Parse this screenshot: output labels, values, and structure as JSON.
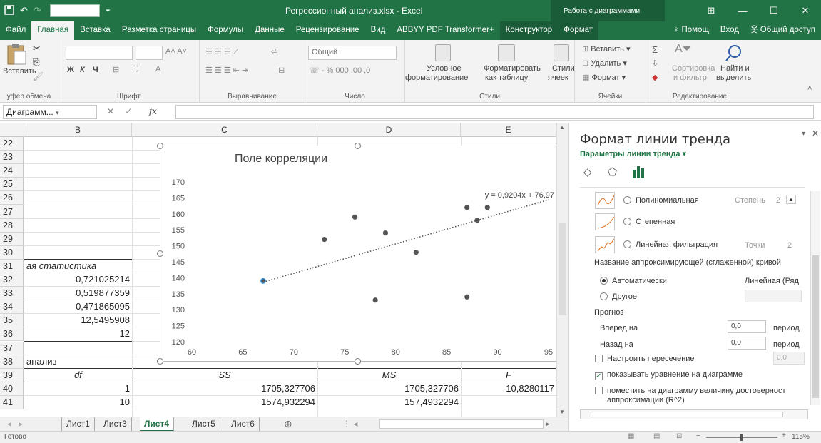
{
  "titlebar": {
    "title": "Регрессионный анализ.xlsx - Excel",
    "context": "Работа с диаграммами"
  },
  "tabs": [
    "Файл",
    "Главная",
    "Вставка",
    "Разметка страницы",
    "Формулы",
    "Данные",
    "Рецензирование",
    "Вид",
    "ABBYY PDF Transformer+",
    "Конструктор",
    "Формат"
  ],
  "tabs_right": {
    "help": "Помощ",
    "signin": "Вход",
    "share": "Общий доступ"
  },
  "ribbon": {
    "paste": "Вставить",
    "clipboard": "уфер обмена",
    "font_group": "Шрифт",
    "bold": "Ж",
    "italic": "К",
    "underline": "Ч",
    "align_group": "Выравнивание",
    "number_format": "Общий",
    "number_group": "Число",
    "cond_format_1": "Условное",
    "cond_format_2": "форматирование",
    "as_table_1": "Форматировать",
    "as_table_2": "как таблицу",
    "styles_1": "Стили",
    "styles_2": "ячеек",
    "styles_group": "Стили",
    "insert": "Вставить",
    "delete": "Удалить",
    "format": "Формат",
    "cells_group": "Ячейки",
    "sort_1": "Сортировка",
    "sort_2": "и фильтр",
    "find_1": "Найти и",
    "find_2": "выделить",
    "edit_group": "Редактирование"
  },
  "formula_bar": {
    "name_box": "Диаграмм...",
    "fx": "fx"
  },
  "columns": [
    "B",
    "C",
    "D",
    "E"
  ],
  "rows": [
    {
      "n": "22",
      "b": "",
      "c": "",
      "d": "",
      "e": ""
    },
    {
      "n": "23",
      "b": "",
      "c": "",
      "d": "",
      "e": ""
    },
    {
      "n": "24",
      "b": "",
      "c": "",
      "d": "",
      "e": ""
    },
    {
      "n": "25",
      "b": "",
      "c": "",
      "d": "",
      "e": ""
    },
    {
      "n": "26",
      "b": "",
      "c": "",
      "d": "",
      "e": ""
    },
    {
      "n": "27",
      "b": "",
      "c": "",
      "d": "",
      "e": ""
    },
    {
      "n": "28",
      "b": "",
      "c": "",
      "d": "",
      "e": ""
    },
    {
      "n": "29",
      "b": "",
      "c": "",
      "d": "",
      "e": ""
    },
    {
      "n": "30",
      "b": "",
      "c": "",
      "d": "",
      "e": ""
    },
    {
      "n": "31",
      "b": "ая статистика",
      "c": "",
      "d": "",
      "e": ""
    },
    {
      "n": "32",
      "b": "0,721025214",
      "c": "",
      "d": "",
      "e": ""
    },
    {
      "n": "33",
      "b": "0,519877359",
      "c": "",
      "d": "",
      "e": ""
    },
    {
      "n": "34",
      "b": "0,471865095",
      "c": "",
      "d": "",
      "e": ""
    },
    {
      "n": "35",
      "b": "12,5495908",
      "c": "",
      "d": "",
      "e": ""
    },
    {
      "n": "36",
      "b": "12",
      "c": "",
      "d": "",
      "e": ""
    },
    {
      "n": "37",
      "b": "",
      "c": "",
      "d": "",
      "e": ""
    },
    {
      "n": "38",
      "b": "анализ",
      "c": "",
      "d": "",
      "e": ""
    },
    {
      "n": "39",
      "b": "df",
      "c": "SS",
      "d": "MS",
      "e": "F"
    },
    {
      "n": "40",
      "b": "1",
      "c": "1705,327706",
      "d": "1705,327706",
      "e": "10,8280117"
    },
    {
      "n": "41",
      "b": "10",
      "c": "1574,932294",
      "d": "157,4932294",
      "e": ""
    }
  ],
  "chart_data": {
    "type": "scatter",
    "title": "Поле корреляции",
    "xlim": [
      60,
      95
    ],
    "ylim": [
      120,
      170
    ],
    "xticks": [
      60,
      65,
      70,
      75,
      80,
      85,
      90,
      95
    ],
    "yticks": [
      120,
      125,
      130,
      135,
      140,
      145,
      150,
      155,
      160,
      165,
      170
    ],
    "grid": false,
    "points": [
      {
        "x": 67,
        "y": 139
      },
      {
        "x": 73,
        "y": 152
      },
      {
        "x": 76,
        "y": 159
      },
      {
        "x": 78,
        "y": 133
      },
      {
        "x": 79,
        "y": 154
      },
      {
        "x": 82,
        "y": 148
      },
      {
        "x": 87,
        "y": 162
      },
      {
        "x": 87,
        "y": 134
      },
      {
        "x": 88,
        "y": 158
      },
      {
        "x": 89,
        "y": 162
      }
    ],
    "trendline": {
      "slope": 0.9204,
      "intercept": 76.97,
      "label": "y = 0,9204x + 76,97"
    }
  },
  "sheet_tabs": [
    "Лист1",
    "Лист3",
    "Лист4",
    "Лист5",
    "Лист6"
  ],
  "active_sheet": "Лист4",
  "status": {
    "ready": "Готово",
    "zoom": "115%"
  },
  "pane": {
    "title": "Формат линии тренда",
    "subtitle": "Параметры линии тренда",
    "polynomial": "Полиномиальная",
    "degree_label": "Степень",
    "degree_value": "2",
    "power": "Степенная",
    "moving_avg": "Линейная фильтрация",
    "points_label": "Точки",
    "points_value": "2",
    "name_heading": "Название аппроксимирующей (сглаженной) кривой",
    "auto": "Автоматически",
    "auto_value": "Линейная (Ряд",
    "custom": "Другое",
    "forecast": "Прогноз",
    "forward": "Вперед на",
    "forward_value": "0,0",
    "backward": "Назад на",
    "backward_value": "0,0",
    "periods": "период",
    "intercept": "Настроить пересечение",
    "intercept_value": "0,0",
    "show_eq": "показывать уравнение на диаграмме",
    "show_r2_1": "поместить на диаграмму величину достоверност",
    "show_r2_2": "аппроксимации (R^2)"
  }
}
